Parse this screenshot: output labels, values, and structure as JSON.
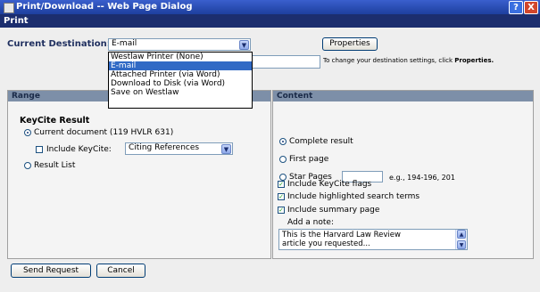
{
  "window": {
    "title": "Print/Download -- Web Page Dialog",
    "help_label": "?",
    "close_label": "X"
  },
  "header": {
    "section_title": "Print"
  },
  "destination": {
    "label": "Current Destination:",
    "selected": "E-mail",
    "options": [
      "Westlaw Printer (None)",
      "E-mail",
      "Attached Printer (via Word)",
      "Download to Disk (via Word)",
      "Save on Westlaw"
    ],
    "properties_button": "Properties",
    "hint_prefix": "To change your destination settings, click ",
    "hint_emphasis": "Properties."
  },
  "range": {
    "header": "Range",
    "section_title": "KeyCite Result",
    "current_document": "Current document (119 HVLR 631)",
    "include_keycite_label": "Include KeyCite:",
    "include_keycite_checked": false,
    "keycite_select": "Citing References",
    "result_list": "Result List",
    "selected": "current_document"
  },
  "content": {
    "header": "Content",
    "complete_result": "Complete result",
    "first_page": "First page",
    "star_pages": "Star Pages",
    "star_pages_value": "",
    "star_pages_example": "e.g., 194-196, 201",
    "selected": "complete_result",
    "include_keycite_flags": "Include KeyCite flags",
    "include_highlighted": "Include highlighted search terms",
    "include_summary": "Include summary page",
    "flags_checked": true,
    "highlighted_checked": true,
    "summary_checked": true,
    "note_label": "Add a note:",
    "note_line1": "This is the Harvard Law Review",
    "note_line2": "article you requested..."
  },
  "footer": {
    "send_button": "Send Request",
    "cancel_button": "Cancel"
  },
  "colors": {
    "titlebar": "#1d3f9e",
    "subbar": "#1c2e6e",
    "panel_header": "#7d8fa8",
    "selection": "#316ac5"
  }
}
